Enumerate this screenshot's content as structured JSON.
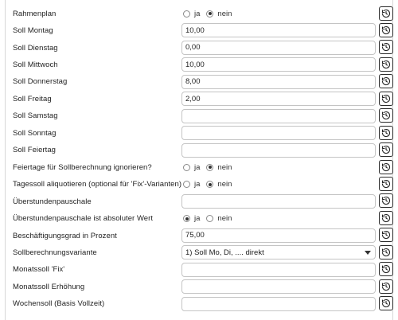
{
  "rows": [
    {
      "label": "Rahmenplan",
      "type": "radio",
      "options": [
        {
          "label": "ja",
          "checked": false
        },
        {
          "label": "nein",
          "checked": true
        }
      ]
    },
    {
      "label": "Soll Montag",
      "type": "text",
      "value": "10,00"
    },
    {
      "label": "Soll Dienstag",
      "type": "text",
      "value": "0,00"
    },
    {
      "label": "Soll Mittwoch",
      "type": "text",
      "value": "10,00"
    },
    {
      "label": "Soll Donnerstag",
      "type": "text",
      "value": "8,00"
    },
    {
      "label": "Soll Freitag",
      "type": "text",
      "value": "2,00"
    },
    {
      "label": "Soll Samstag",
      "type": "text",
      "value": ""
    },
    {
      "label": "Soll Sonntag",
      "type": "text",
      "value": ""
    },
    {
      "label": "Soll Feiertag",
      "type": "text",
      "value": ""
    },
    {
      "label": "Feiertage für Sollberechnung ignorieren?",
      "type": "radio",
      "options": [
        {
          "label": "ja",
          "checked": false
        },
        {
          "label": "nein",
          "checked": true
        }
      ]
    },
    {
      "label": "Tagessoll aliquotieren (optional für 'Fix'-Varianten)",
      "type": "radio",
      "options": [
        {
          "label": "ja",
          "checked": false
        },
        {
          "label": "nein",
          "checked": true
        }
      ]
    },
    {
      "label": "Überstundenpauschale",
      "type": "text",
      "value": ""
    },
    {
      "label": "Überstundenpauschale ist absoluter Wert",
      "type": "radio",
      "options": [
        {
          "label": "ja",
          "checked": true
        },
        {
          "label": "nein",
          "checked": false
        }
      ]
    },
    {
      "label": "Beschäftigungsgrad in Prozent",
      "type": "text",
      "value": "75,00"
    },
    {
      "label": "Sollberechnungsvariante",
      "type": "select",
      "value": "1) Soll Mo, Di, .... direkt"
    },
    {
      "label": "Monatssoll 'Fix'",
      "type": "text",
      "value": ""
    },
    {
      "label": "Monatssoll Erhöhung",
      "type": "text",
      "value": ""
    },
    {
      "label": "Wochensoll (Basis Vollzeit)",
      "type": "text",
      "value": ""
    }
  ],
  "history_button_icon": "history-icon"
}
